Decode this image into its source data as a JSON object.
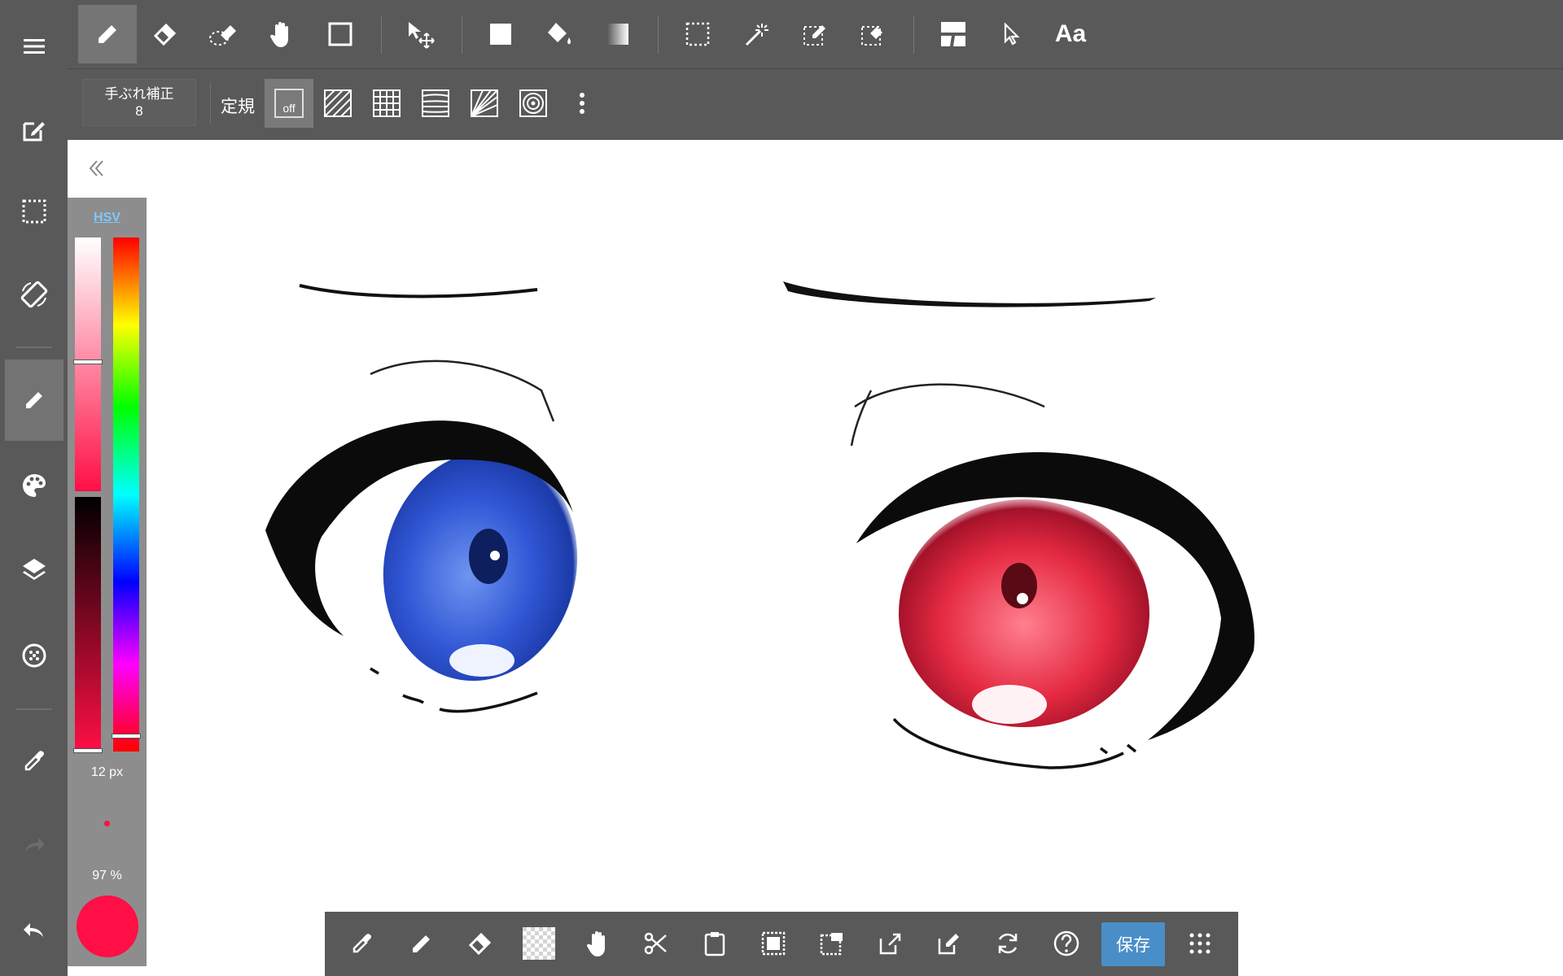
{
  "top_toolbar": {
    "tools": [
      {
        "name": "pen-tool",
        "icon": "pencil-icon",
        "active": true
      },
      {
        "name": "eraser-tool",
        "icon": "eraser-icon"
      },
      {
        "name": "blur-tool",
        "icon": "blur-icon"
      },
      {
        "name": "hand-tool",
        "icon": "hand-icon"
      },
      {
        "name": "shape-tool",
        "icon": "square-outline-icon"
      },
      {
        "name": "move-tool",
        "icon": "move-arrow-icon"
      },
      {
        "name": "fill-rect-tool",
        "icon": "filled-square-icon"
      },
      {
        "name": "bucket-tool",
        "icon": "paint-bucket-icon"
      },
      {
        "name": "gradient-tool",
        "icon": "gradient-icon"
      },
      {
        "name": "select-tool",
        "icon": "select-rect-icon"
      },
      {
        "name": "magic-wand-tool",
        "icon": "magic-wand-icon"
      },
      {
        "name": "select-pen-tool",
        "icon": "select-pen-icon"
      },
      {
        "name": "select-eraser-tool",
        "icon": "select-eraser-icon"
      },
      {
        "name": "frame-tool",
        "icon": "panel-divider-icon"
      },
      {
        "name": "operation-tool",
        "icon": "pointer-icon"
      }
    ],
    "text_tool_label": "Aa"
  },
  "sub_toolbar": {
    "stabilizer_label": "手ぶれ補正",
    "stabilizer_value": "8",
    "ruler_label": "定規",
    "ruler_off_label": "off"
  },
  "color_panel": {
    "mode_label": "HSV",
    "brush_size": "12 px",
    "opacity": "97 %",
    "current_color": "#ff0f45",
    "saturation_level": 0.49,
    "value_level": 1.0,
    "hue_level": 0.99
  },
  "bottom_toolbar": {
    "save_label": "保存"
  },
  "colors": {
    "toolbar_bg": "#595959",
    "panel_bg": "#8d8d8d",
    "accent_blue": "#4a8ec8",
    "hsv_link": "#7ec7ff"
  }
}
